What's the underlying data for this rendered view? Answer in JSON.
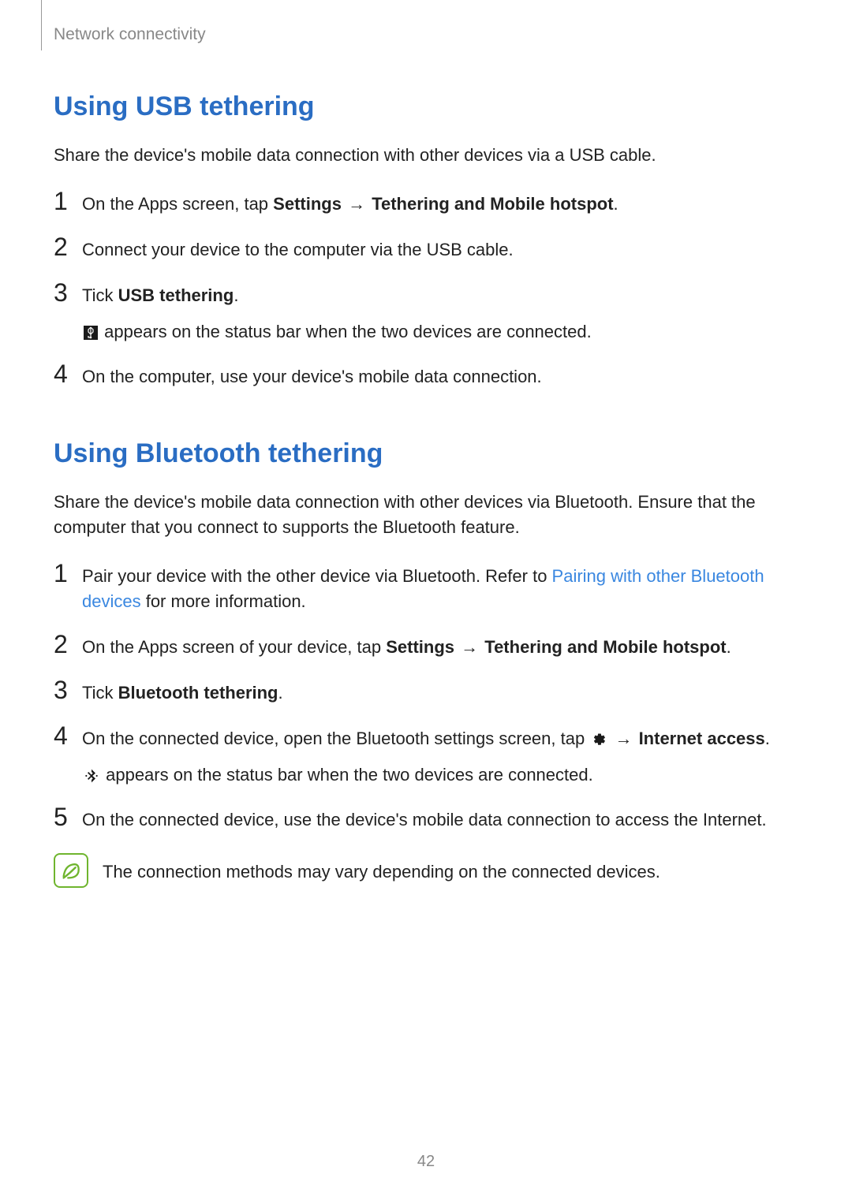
{
  "breadcrumb": "Network connectivity",
  "usb_section": {
    "heading": "Using USB tethering",
    "intro": "Share the device's mobile data connection with other devices via a USB cable.",
    "steps": [
      {
        "num": "1",
        "prefix": "On the Apps screen, tap ",
        "bold1": "Settings",
        "arrow": " → ",
        "bold2": "Tethering and Mobile hotspot",
        "suffix": "."
      },
      {
        "num": "2",
        "text": "Connect your device to the computer via the USB cable."
      },
      {
        "num": "3",
        "prefix": "Tick ",
        "bold1": "USB tethering",
        "suffix": ".",
        "sub": " appears on the status bar when the two devices are connected."
      },
      {
        "num": "4",
        "text": "On the computer, use your device's mobile data connection."
      }
    ]
  },
  "bt_section": {
    "heading": "Using Bluetooth tethering",
    "intro": "Share the device's mobile data connection with other devices via Bluetooth. Ensure that the computer that you connect to supports the Bluetooth feature.",
    "steps": [
      {
        "num": "1",
        "prefix": "Pair your device with the other device via Bluetooth. Refer to ",
        "link": "Pairing with other Bluetooth devices",
        "suffix": " for more information."
      },
      {
        "num": "2",
        "prefix": "On the Apps screen of your device, tap ",
        "bold1": "Settings",
        "arrow": " → ",
        "bold2": "Tethering and Mobile hotspot",
        "suffix": "."
      },
      {
        "num": "3",
        "prefix": "Tick ",
        "bold1": "Bluetooth tethering",
        "suffix": "."
      },
      {
        "num": "4",
        "prefix": "On the connected device, open the Bluetooth settings screen, tap ",
        "arrow": " → ",
        "bold2": "Internet access",
        "suffix": ".",
        "sub": " appears on the status bar when the two devices are connected."
      },
      {
        "num": "5",
        "text": "On the connected device, use the device's mobile data connection to access the Internet."
      }
    ]
  },
  "note": "The connection methods may vary depending on the connected devices.",
  "page_number": "42"
}
